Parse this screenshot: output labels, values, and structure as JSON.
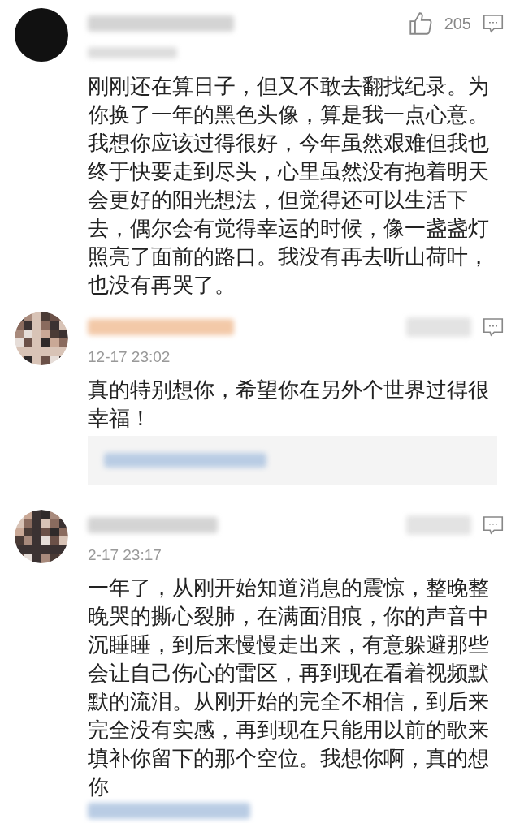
{
  "comments": [
    {
      "avatar": {
        "kind": "solid"
      },
      "likes": "205",
      "text": "刚刚还在算日子，但又不敢去翻找纪录。为你换了一年的黑色头像，算是我一点心意。我想你应该过得很好，今年虽然艰难但我也终于快要走到尽头，心里虽然没有抱着明天会更好的阳光想法，但觉得还可以生活下去，偶尔会有觉得幸运的时候，像一盏盏灯照亮了面前的路口。我没有再去听山荷叶，也没有再哭了。",
      "reply_box": false,
      "trailing_link": false
    },
    {
      "avatar": {
        "kind": "pixelated"
      },
      "time": "12-17 23:02",
      "text": "真的特别想你，希望你在另外个世界过得很幸福！",
      "reply_box": true,
      "trailing_link": false
    },
    {
      "avatar": {
        "kind": "pixelated"
      },
      "time": "2-17 23:17",
      "text": "一年了，从刚开始知道消息的震惊，整晚整晚哭的撕心裂肺，在满面泪痕，你的声音中沉睡睡，到后来慢慢走出来，有意躲避那些会让自己伤心的雷区，再到现在看着视频默默的流泪。从刚开始的完全不相信，到后来完全没有实感，再到现在只能用以前的歌来填补你留下的那个空位。我想你啊，真的想你",
      "reply_box": false,
      "trailing_link": true
    }
  ]
}
